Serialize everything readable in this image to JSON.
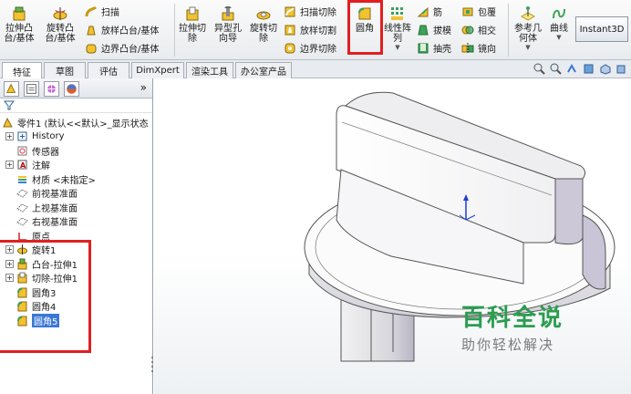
{
  "ribbon": {
    "extrude_boss": "拉伸凸\n台/基体",
    "revolve_boss": "旋转凸\n台/基体",
    "sweep": "扫描",
    "loft_boss": "放样凸台/基体",
    "boundary_boss": "边界凸台/基体",
    "extrude_cut": "拉伸切\n除",
    "hole_wizard": "异型孔\n向导",
    "revolve_cut": "旋转切\n除",
    "swept_cut": "扫描切除",
    "lofted_cut": "放样切割",
    "boundary_cut": "边界切除",
    "fillet": "圆角",
    "linear_pattern": "线性阵\n列",
    "rib": "筋",
    "draft": "拔模",
    "shell": "抽壳",
    "wrap": "包覆",
    "intersect": "相交",
    "mirror": "镜向",
    "ref_geometry": "参考几\n何体",
    "curves": "曲线",
    "instant3d": "Instant3D"
  },
  "tabs": [
    "特征",
    "草图",
    "评估",
    "DimXpert",
    "渲染工具",
    "办公室产品"
  ],
  "active_tab": "特征",
  "tree": {
    "root": "零件1  (默认<<默认>_显示状态",
    "items": [
      {
        "label": "History",
        "icon": "history-icon",
        "expandable": true
      },
      {
        "label": "传感器",
        "icon": "sensor-icon",
        "expandable": false
      },
      {
        "label": "注解",
        "icon": "annotation-icon",
        "expandable": true
      },
      {
        "label": "材质 <未指定>",
        "icon": "material-icon",
        "expandable": false
      },
      {
        "label": "前视基准面",
        "icon": "plane-icon",
        "expandable": false
      },
      {
        "label": "上视基准面",
        "icon": "plane-icon",
        "expandable": false
      },
      {
        "label": "右视基准面",
        "icon": "plane-icon",
        "expandable": false
      },
      {
        "label": "原点",
        "icon": "origin-icon",
        "expandable": false
      },
      {
        "label": "旋转1",
        "icon": "revolve-icon",
        "expandable": true
      },
      {
        "label": "凸台-拉伸1",
        "icon": "extrude-icon",
        "expandable": true
      },
      {
        "label": "切除-拉伸1",
        "icon": "cut-icon",
        "expandable": true
      },
      {
        "label": "圆角3",
        "icon": "fillet-icon",
        "expandable": false
      },
      {
        "label": "圆角4",
        "icon": "fillet-icon",
        "expandable": false
      },
      {
        "label": "圆角5",
        "icon": "fillet-icon",
        "expandable": false,
        "selected": true
      }
    ]
  },
  "watermark": {
    "title": "百科全说",
    "subtitle": "助你轻松解决"
  },
  "colors": {
    "highlight_red": "#e02020",
    "selection_blue": "#3b77d6",
    "watermark_green": "#2a9d4f"
  }
}
